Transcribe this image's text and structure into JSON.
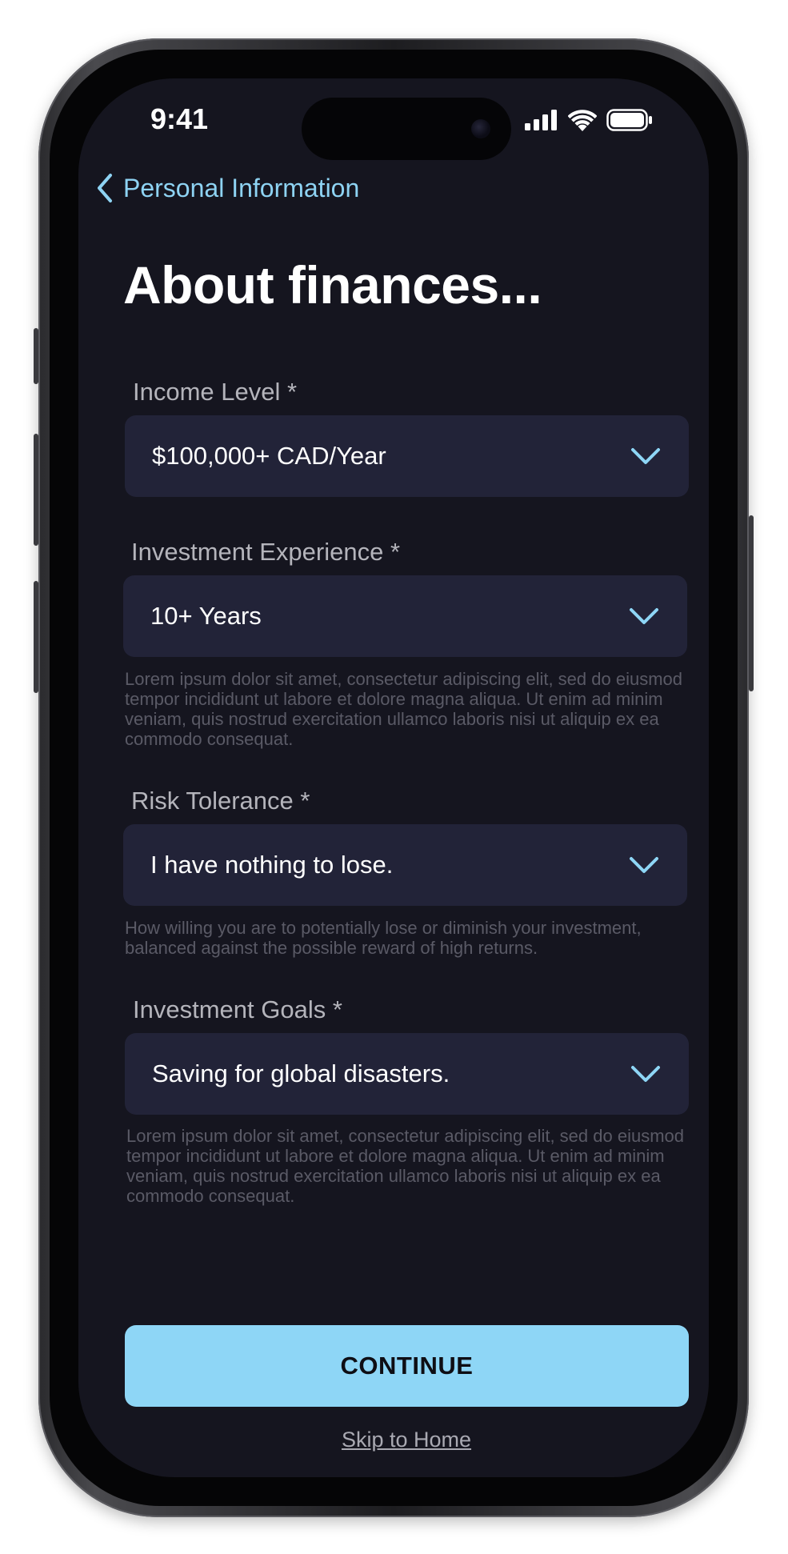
{
  "status_bar": {
    "time": "9:41",
    "icons": [
      "signal-icon",
      "wifi-icon",
      "battery-icon"
    ]
  },
  "nav": {
    "back_label": "Personal Information",
    "back_icon": "chevron-left-icon"
  },
  "page": {
    "title": "About finances..."
  },
  "fields": [
    {
      "label": "Income Level *",
      "value": "$100,000+ CAD/Year",
      "helper": ""
    },
    {
      "label": "Investment Experience *",
      "value": "10+ Years",
      "helper": "Lorem ipsum dolor sit amet, consectetur adipiscing elit, sed do eiusmod tempor incididunt ut labore et dolore magna aliqua. Ut enim ad minim veniam, quis nostrud exercitation ullamco laboris nisi ut aliquip ex ea commodo consequat."
    },
    {
      "label": "Risk Tolerance *",
      "value": "I have nothing to lose.",
      "helper": "How willing you are to potentially lose or diminish your investment, balanced against the possible reward of high returns."
    },
    {
      "label": "Investment Goals *",
      "value": "Saving for global disasters.",
      "helper": "Lorem ipsum dolor sit amet, consectetur adipiscing elit, sed do eiusmod tempor incididunt ut labore et dolore magna aliqua. Ut enim ad minim veniam, quis nostrud exercitation ullamco laboris nisi ut aliquip ex ea commodo consequat."
    }
  ],
  "actions": {
    "continue_label": "CONTINUE",
    "skip_label": "Skip to Home"
  },
  "colors": {
    "background": "#15151f",
    "field_bg": "#222338",
    "accent": "#8ed6f6",
    "label": "#b4b4bb",
    "helper": "#5a5a66"
  }
}
